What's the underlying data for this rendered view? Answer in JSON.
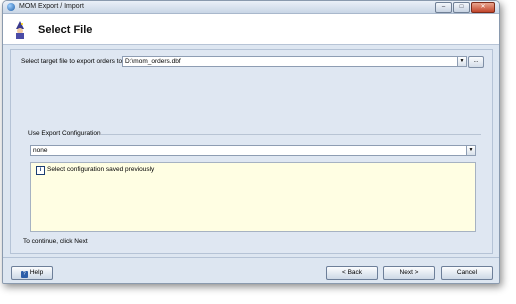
{
  "window": {
    "title": "MOM Export / Import"
  },
  "header": {
    "title": "Select File"
  },
  "target": {
    "label": "Select target file to export orders to",
    "value": "D:\\mom_orders.dbf",
    "browse_label": "..."
  },
  "config": {
    "section_label": "Use Export Configuration",
    "value": "none",
    "info_text": "Select configuration saved previously"
  },
  "continue_text": "To continue, click Next",
  "buttons": {
    "help": "Help",
    "back": "< Back",
    "next": "Next >",
    "cancel": "Cancel"
  },
  "icons": {
    "app": "app-globe-icon",
    "wizard": "wizard-icon",
    "info": "info-icon",
    "help": "help-book-icon"
  }
}
